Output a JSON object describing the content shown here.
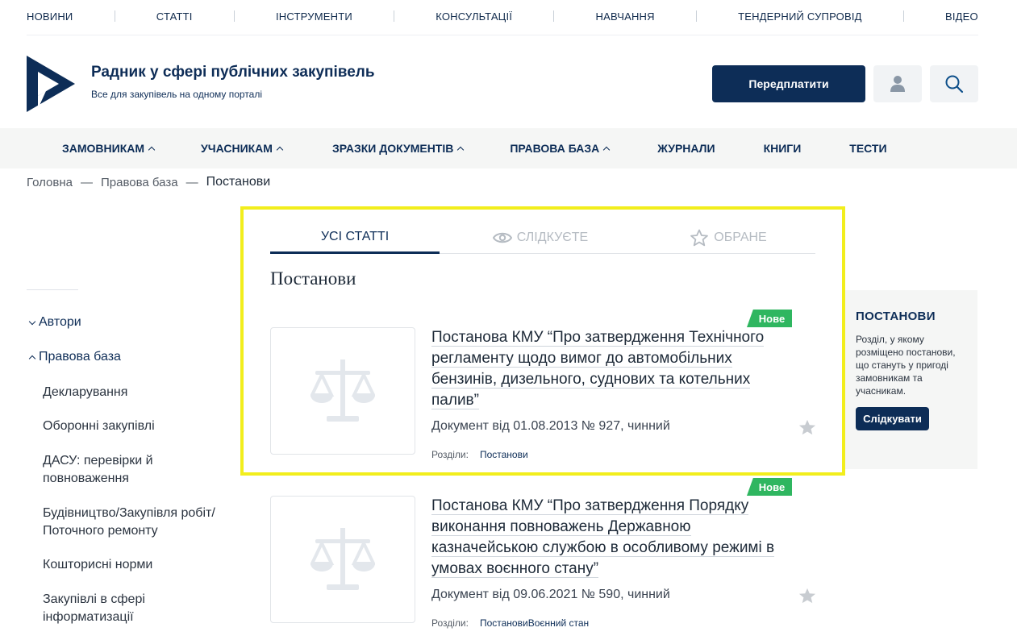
{
  "topnav": {
    "items": [
      "НОВИНИ",
      "СТАТТІ",
      "ІНСТРУМЕНТИ",
      "КОНСУЛЬТАЦІЇ",
      "НАВЧАННЯ",
      "ТЕНДЕРНИЙ СУПРОВІД",
      "ВІДЕО"
    ]
  },
  "header": {
    "title": "Радник у сфері публічних закупівель",
    "subtitle": "Все для закупівель на одному порталі",
    "subscribe_label": "Передплатити",
    "user_icon": "user-icon",
    "search_icon": "search-icon"
  },
  "mainnav": {
    "items": [
      "ЗАМОВНИКАМ",
      "УЧАСНИКАМ",
      "ЗРАЗКИ ДОКУМЕНТІВ",
      "ПРАВОВА БАЗА",
      "ЖУРНАЛИ",
      "КНИГИ",
      "ТЕСТИ"
    ]
  },
  "breadcrumb": {
    "home": "Головна",
    "sep": "—",
    "parent": "Правова база",
    "current": "Постанови"
  },
  "sidebar": {
    "authors": "Автори",
    "legal": "Правова база",
    "subitems": [
      "Декларування",
      "Оборонні закупівлі",
      "ДАСУ: перевірки й повноваження",
      "Будівництво/Закупівля робіт/ Поточного ремонту",
      "Кошторисні норми",
      "Закупівлі в сфері інформатизації"
    ]
  },
  "tabs": {
    "all": "УСІ СТАТТІ",
    "follow": "СЛІДКУЄТЕ",
    "favorites": "ОБРАНЕ"
  },
  "section_title": "Постанови",
  "articles": [
    {
      "badge": "Нове",
      "title": "Постанова КМУ “Про затвердження Технічного регламенту щодо вимог до автомобільних бензинів, дизельного, суднових та котельних палив”",
      "meta": "Документ від 01.08.2013 № 927, чинний",
      "sections_label": "Розділи:",
      "sections": [
        "Постанови"
      ]
    },
    {
      "badge": "Нове",
      "title": "Постанова КМУ “Про затвердження Порядку виконання повноважень Державною казначейською службою в особливому режимі в умовах воєнного стану”",
      "meta": "Документ від 09.06.2021 № 590, чинний",
      "sections_label": "Розділи:",
      "sections": [
        "Постанови",
        "Воєнний стан"
      ]
    }
  ],
  "info_box": {
    "title": "ПОСТАНОВИ",
    "text": "Розділ, у якому розміщено постанови, що стануть у пригоді замовникам та учасникам.",
    "button": "Слідкувати"
  },
  "colors": {
    "brand": "#0d2d57",
    "badge": "#2fb660",
    "highlight": "#f2ee1c"
  }
}
